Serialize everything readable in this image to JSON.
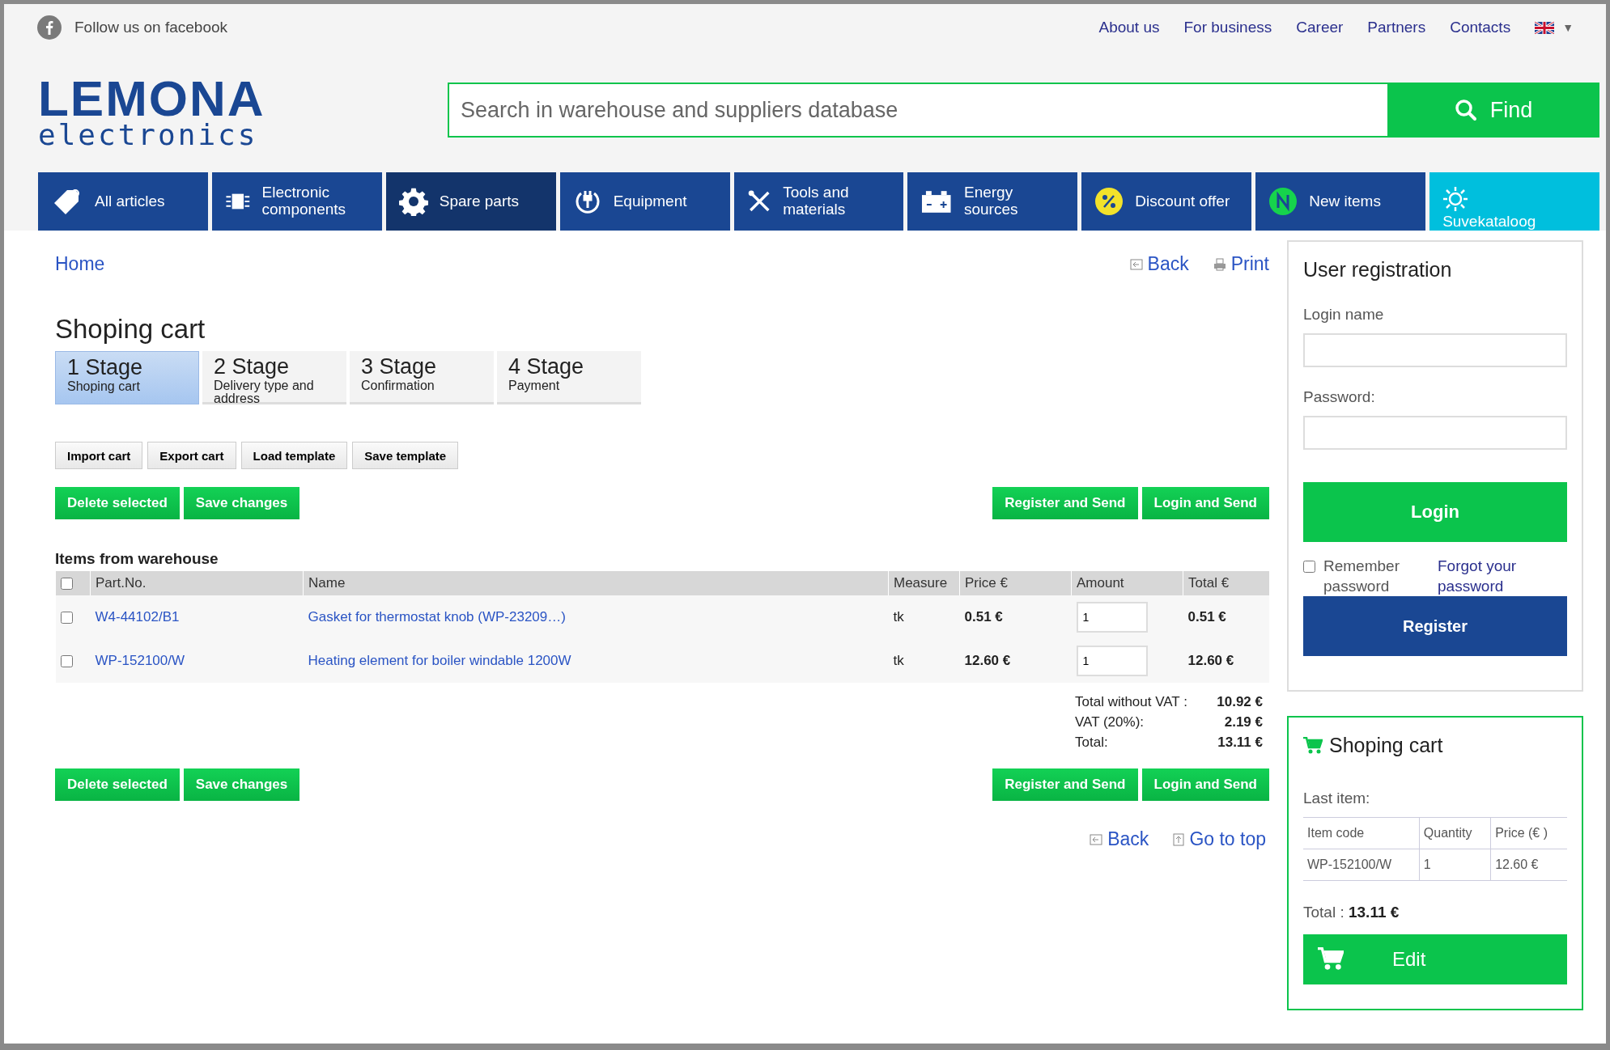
{
  "top_bar": {
    "social_link": "Follow us on facebook",
    "links": [
      "About us",
      "For business",
      "Career",
      "Partners",
      "Contacts"
    ],
    "language_caret": "▼"
  },
  "logo": {
    "title": "LEMONA",
    "subtitle": "electronics"
  },
  "search": {
    "placeholder": "Search in warehouse and suppliers database",
    "button": "Find"
  },
  "nav": [
    {
      "label": "All articles",
      "selected": false,
      "kind": "normal"
    },
    {
      "label": "Electronic components",
      "selected": false,
      "kind": "normal"
    },
    {
      "label": "Spare parts",
      "selected": true,
      "kind": "normal"
    },
    {
      "label": "Equipment",
      "selected": false,
      "kind": "normal"
    },
    {
      "label": "Tools and materials",
      "selected": false,
      "kind": "normal"
    },
    {
      "label": "Energy sources",
      "selected": false,
      "kind": "normal"
    },
    {
      "label": "Discount offer",
      "selected": false,
      "kind": "normal"
    },
    {
      "label": "New items",
      "selected": false,
      "kind": "normal"
    },
    {
      "label": "Suvekataloog",
      "selected": false,
      "kind": "featured"
    }
  ],
  "breadcrumb": "Home",
  "top_actions": [
    "Back",
    "Print"
  ],
  "title": "Shoping cart",
  "stages": [
    {
      "number": "1 Stage",
      "label": "Shoping cart",
      "selected": true
    },
    {
      "number": "2 Stage",
      "label": "Delivery type and address",
      "selected": false
    },
    {
      "number": "3 Stage",
      "label": "Confirmation",
      "selected": false
    },
    {
      "number": "4 Stage",
      "label": "Payment",
      "selected": false
    }
  ],
  "cart_tools": [
    "Import cart",
    "Export cart",
    "Load template",
    "Save template"
  ],
  "actions_left": [
    "Delete selected",
    "Save changes"
  ],
  "actions_right": [
    "Register and Send",
    "Login and Send"
  ],
  "table": {
    "heading": "Items from warehouse",
    "select_all": false,
    "columns": [
      "Part.No.",
      "Name",
      "Measure",
      "Price €",
      "Amount",
      "Total €"
    ],
    "rows": [
      {
        "checked": false,
        "part_no": "W4-44102/B1",
        "name": "Gasket for thermostat knob (WP-23209…)",
        "measure": "tk",
        "price": "0.51 €",
        "amount": "1",
        "total": "0.51 €"
      },
      {
        "checked": false,
        "part_no": "WP-152100/W",
        "name": "Heating element for boiler windable 1200W",
        "measure": "tk",
        "price": "12.60 €",
        "amount": "1",
        "total": "12.60 €"
      }
    ]
  },
  "totals": [
    {
      "label": "Total without VAT :",
      "value": "10.92 €"
    },
    {
      "label": "VAT (20%):",
      "value": "2.19 €"
    },
    {
      "label": "Total:",
      "value": "13.11 €"
    }
  ],
  "actions_left_bottom": [
    "Delete selected",
    "Save changes"
  ],
  "actions_right_bottom": [
    "Register and Send",
    "Login and Send"
  ],
  "bottom_links": [
    "Back",
    "Go to top"
  ],
  "registration": {
    "title": "User registration",
    "login_label": "Login name",
    "password_label": "Password:",
    "login_button": "Login",
    "remember": {
      "label": "Remember password",
      "checked": false
    },
    "forgot_link": "Forgot your password",
    "register_button": "Register"
  },
  "mini_cart": {
    "title": "Shoping cart",
    "last_item_label": "Last item:",
    "columns": [
      "Item code",
      "Quantity",
      "Price (€ )"
    ],
    "row": [
      "WP-152100/W",
      "1",
      "12.60 €"
    ],
    "total_label": "Total :",
    "total_value": "13.11 €",
    "edit_button": "Edit"
  }
}
